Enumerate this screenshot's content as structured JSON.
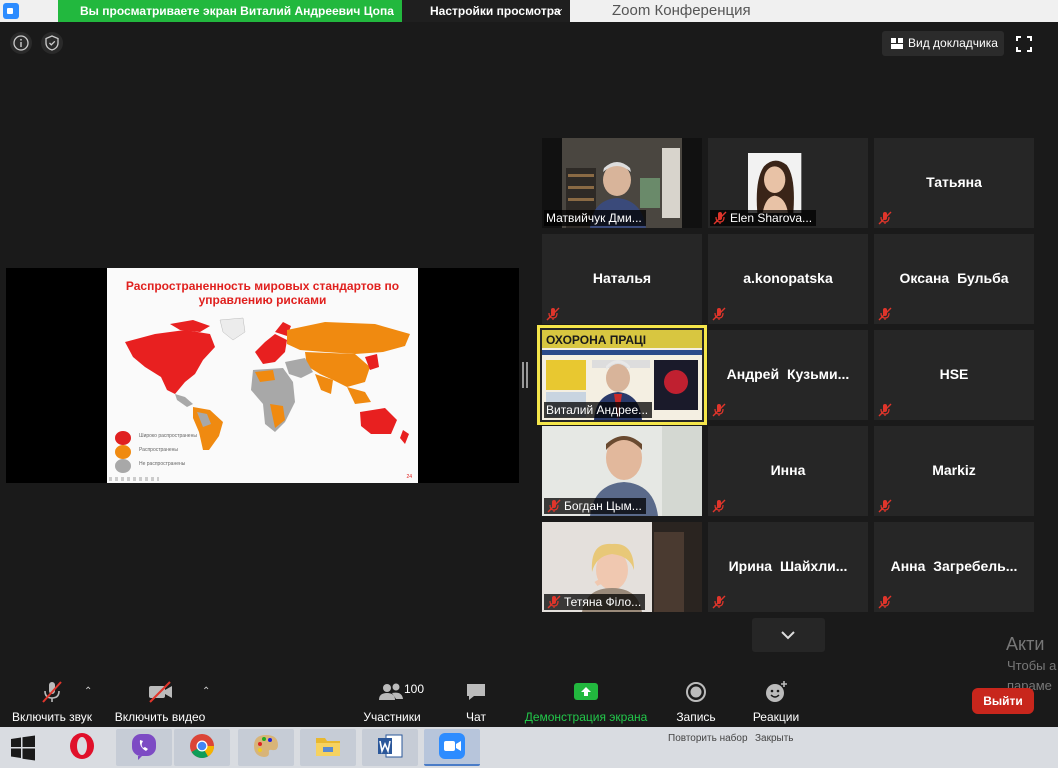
{
  "titlebar": {
    "share_banner": "Вы просматриваете экран Виталий Андреевич Цопа",
    "view_options": "Настройки просмотра",
    "window_title": "Zoom Конференция"
  },
  "top_controls": {
    "speaker_view": "Вид докладчика"
  },
  "shared_slide": {
    "title": "Распространенность мировых стандартов по управлению рисками",
    "legend": [
      {
        "label": "Широко распространены",
        "color": "#e02020"
      },
      {
        "label": "Распространены",
        "color": "#f08a10"
      },
      {
        "label": "Не распространены",
        "color": "#a8a8a8"
      }
    ],
    "page_number": "24"
  },
  "participants": {
    "matviychuk": "Матвийчук Дми...",
    "elen": "Elen Sharova...",
    "tatiana": "Татьяна",
    "natalia": "Наталья",
    "konopatska": "a.konopatska",
    "oksana": "Оксана Бульба",
    "vitaliy": "Виталий Андрее...",
    "andrey": "Андрей Кузьми...",
    "hse": "HSE",
    "bogdan": "Богдан Цым...",
    "inna": "Инна",
    "markiz": "Markiz",
    "tetyana": "Тетяна Філо...",
    "irina": "Ирина Шайхли...",
    "anna": "Анна Загребель..."
  },
  "newspaper": {
    "masthead": "ОХОРОНА ПРАЦІ"
  },
  "toolbar": {
    "unmute": "Включить звук",
    "start_video": "Включить видео",
    "participants": "Участники",
    "participants_count": "100",
    "chat": "Чат",
    "share_screen": "Демонстрация экрана",
    "record": "Запись",
    "reactions": "Реакции",
    "leave": "Выйти"
  },
  "watermark": {
    "line1": "Акти",
    "line2": "Чтобы а",
    "line3": "параме"
  },
  "taskbar": {
    "tray_left": "Повторить набор",
    "tray_right": "Закрыть"
  },
  "colors": {
    "share_green": "#22b83e",
    "leave_red": "#c8261c",
    "mute_red": "#e0352b",
    "active_speaker": "#f5e64a"
  }
}
